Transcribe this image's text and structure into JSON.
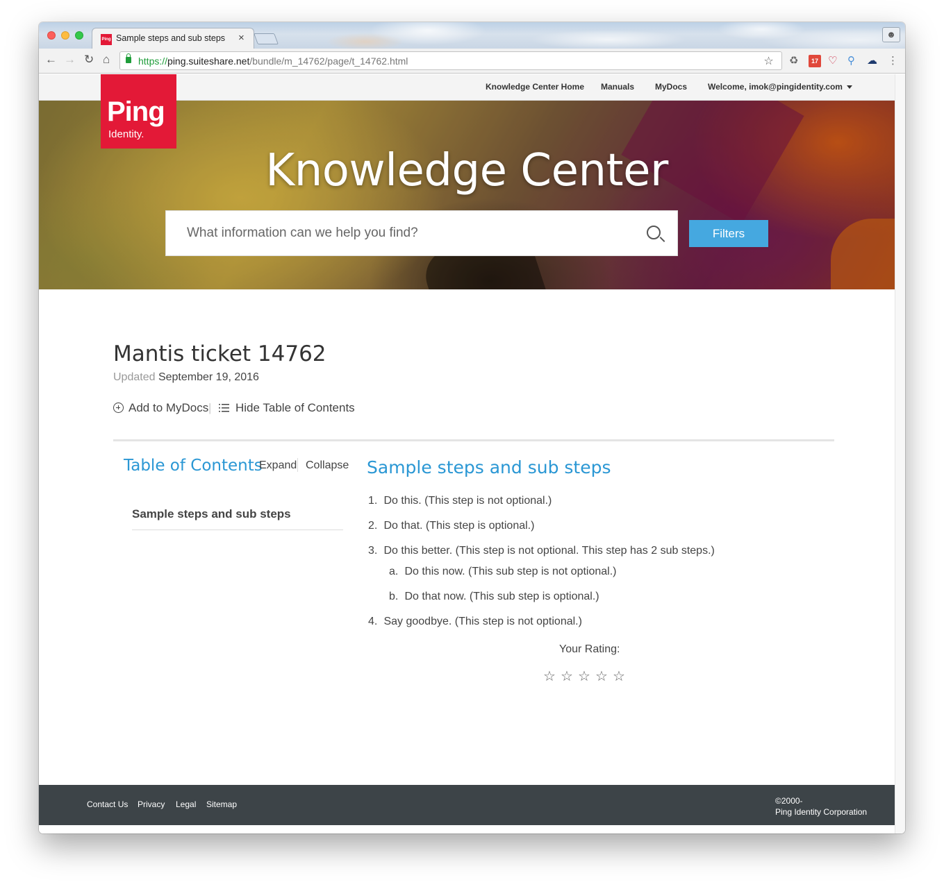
{
  "browser": {
    "tab_title": "Sample steps and sub steps",
    "tab_favicon_text": "Ping",
    "tab_close": "×",
    "url_scheme": "https://",
    "url_host": "ping.suiteshare.net",
    "url_path": "/bundle/m_14762/page/t_14762.html",
    "calendar_ext_label": "17"
  },
  "topnav": {
    "items": [
      "Knowledge Center Home",
      "Manuals",
      "MyDocs",
      "Welcome, imok@pingidentity.com"
    ]
  },
  "logo": {
    "ping": "Ping",
    "identity": "Identity."
  },
  "hero": {
    "title": "Knowledge Center",
    "search_placeholder": "What information can we help you find?",
    "filters_label": "Filters"
  },
  "doc": {
    "title": "Mantis ticket 14762",
    "updated_label": "Updated",
    "updated_date": "September 19, 2016",
    "add_label": "Add to MyDocs",
    "separator": "|",
    "hide_toc_label": "Hide Table of Contents"
  },
  "toc": {
    "title": "Table of Contents",
    "expand": "Expand",
    "collapse": "Collapse",
    "items": [
      "Sample steps and sub steps"
    ]
  },
  "content": {
    "title": "Sample steps and sub steps",
    "steps": [
      {
        "num": "1.",
        "text": "Do this. (This step is not optional.)"
      },
      {
        "num": "2.",
        "text": "Do that. (This step is optional.)"
      },
      {
        "num": "3.",
        "text": "Do this better. (This step is not optional. This step has 2 sub steps.)"
      },
      {
        "num": "a.",
        "text": "Do this now. (This sub step is not optional.)"
      },
      {
        "num": "b.",
        "text": "Do that now. (This sub step is optional.)"
      },
      {
        "num": "4.",
        "text": "Say goodbye. (This step is not optional.)"
      }
    ],
    "rating_label": "Your Rating:",
    "star_glyph": "☆",
    "rating_value": 0,
    "rating_max": 5
  },
  "footer": {
    "links": [
      "Contact Us",
      "Privacy",
      "Legal",
      "Sitemap"
    ],
    "copyright_line1": "©2000-",
    "copyright_line2": "Ping Identity Corporation"
  },
  "colors": {
    "brand_red": "#e31937",
    "link_blue": "#2a97d4",
    "filters_blue": "#45a8e0",
    "footer_bg": "#3d4448"
  }
}
